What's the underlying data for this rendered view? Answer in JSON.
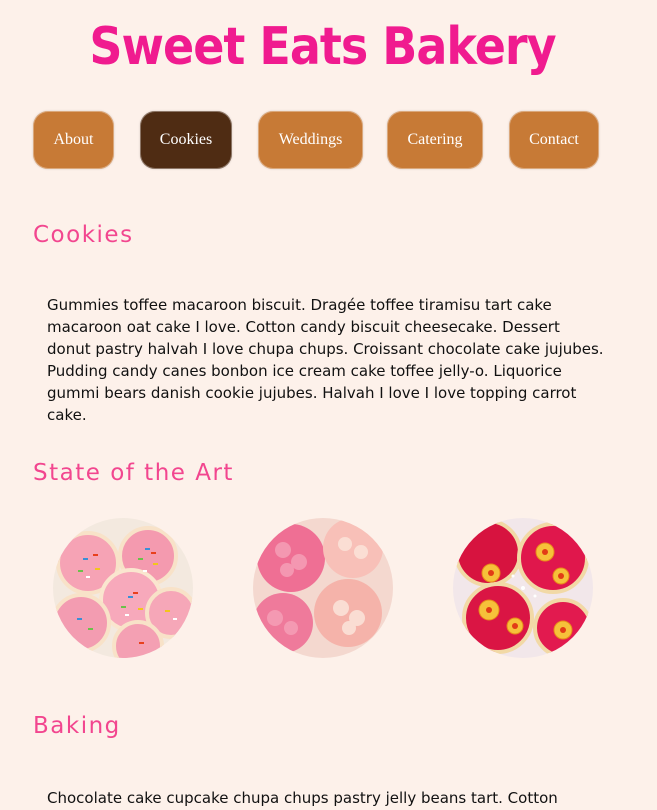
{
  "site": {
    "title": "Sweet Eats Bakery"
  },
  "nav": {
    "items": [
      {
        "label": "About"
      },
      {
        "label": "Cookies"
      },
      {
        "label": "Weddings"
      },
      {
        "label": "Catering"
      },
      {
        "label": "Contact"
      }
    ],
    "active": "Cookies"
  },
  "sections": {
    "cookies": {
      "heading": "Cookies",
      "text": "Gummies toffee macaroon biscuit. Dragée toffee tiramisu tart cake macaroon oat cake I love. Cotton candy biscuit cheesecake. Dessert donut pastry halvah I love chupa chups. Croissant chocolate cake jujubes. Pudding candy canes bonbon ice cream cake toffee jelly-o. Liquorice gummi bears danish cookie jujubes. Halvah I love I love topping carrot cake."
    },
    "art": {
      "heading": "State of the Art",
      "images": [
        {
          "name": "pink-sprinkle-cookies-photo"
        },
        {
          "name": "pink-frosted-rosette-cookies-photo"
        },
        {
          "name": "red-flower-decorated-cookies-photo"
        }
      ]
    },
    "baking": {
      "heading": "Baking",
      "text": "Chocolate cake cupcake chupa chups pastry jelly beans tart. Cotton candy I"
    }
  },
  "colors": {
    "background": "#fdf1ea",
    "title": "#f01b8f",
    "heading": "#f2468f",
    "nav_button": "#c77a36",
    "nav_button_active": "#4f2c13"
  }
}
